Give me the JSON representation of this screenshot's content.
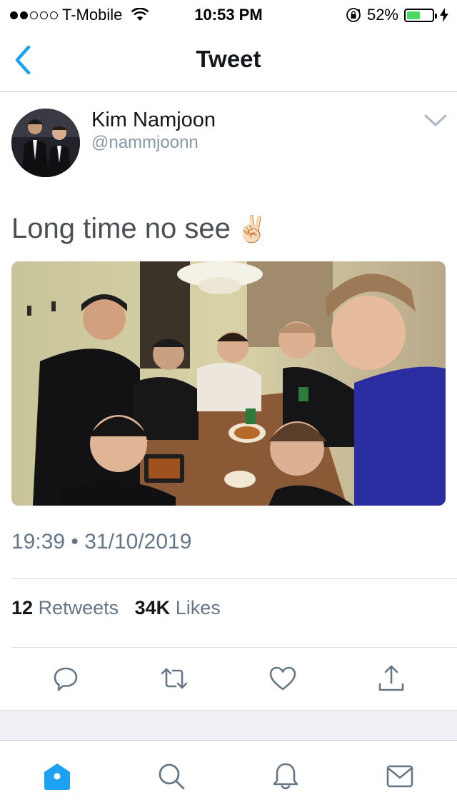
{
  "status_bar": {
    "carrier": "T-Mobile",
    "signal_bars_filled": 2,
    "signal_bars_total": 5,
    "time": "10:53 PM",
    "battery_percent": "52%",
    "battery_level": 0.52,
    "battery_color": "#4cd964"
  },
  "nav": {
    "title": "Tweet",
    "back_icon": "chevron-left-icon"
  },
  "tweet": {
    "author_name": "Kim Namjoon",
    "author_handle": "@nammjoonn",
    "text": "Long time no see",
    "emoji": "✌🏻",
    "timestamp": "19:39 • 31/10/2019",
    "retweets_count": "12",
    "retweets_label": "Retweets",
    "likes_count": "34K",
    "likes_label": "Likes"
  },
  "actions": [
    "reply-icon",
    "retweet-icon",
    "like-icon",
    "share-icon"
  ],
  "tabs": [
    "home-icon",
    "search-icon",
    "notifications-icon",
    "messages-icon"
  ],
  "colors": {
    "accent": "#1da1f2",
    "icon_gray": "#657786",
    "text_primary": "#14171a",
    "text_secondary": "#657786"
  }
}
